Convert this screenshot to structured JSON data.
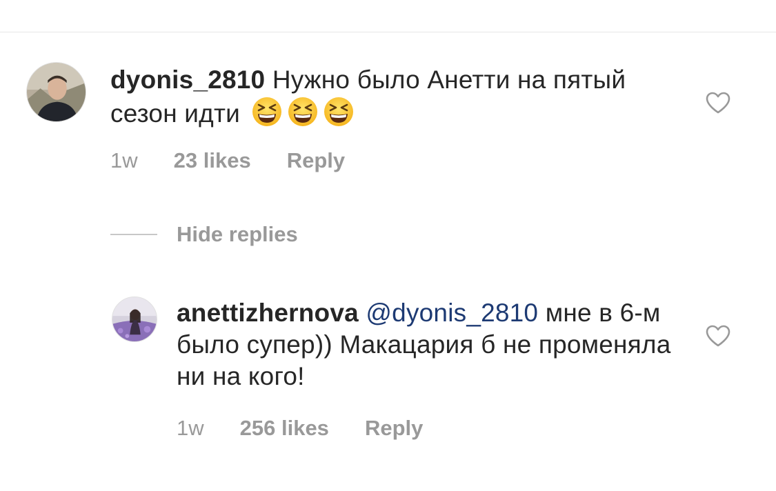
{
  "comments": [
    {
      "username": "dyonis_2810",
      "text": "Нужно было Анетти на пятый сезон идти",
      "emoji_count": 3,
      "emoji_icon": "laughing-face-icon",
      "time": "1w",
      "likes": "23 likes",
      "reply_label": "Reply",
      "like_icon": "heart-outline-icon"
    }
  ],
  "hide_replies_label": "Hide replies",
  "replies": [
    {
      "username": "anettizhernova",
      "mention": "@dyonis_2810",
      "text": "мне в 6-м было супер)) Макацария б не променяла ни на кого!",
      "time": "1w",
      "likes": "256 likes",
      "reply_label": "Reply",
      "like_icon": "heart-outline-icon"
    }
  ],
  "colors": {
    "text": "#262626",
    "muted": "#999999",
    "mention": "#1d3a73",
    "divider": "#e6e6e6"
  }
}
